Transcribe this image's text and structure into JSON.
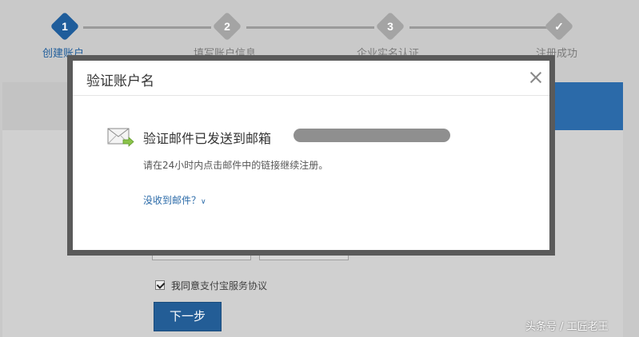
{
  "steps": [
    {
      "number": "1",
      "label": "创建账户",
      "state": "active"
    },
    {
      "number": "2",
      "label": "填写账户信息",
      "state": "pending"
    },
    {
      "number": "3",
      "label": "企业实名认证",
      "state": "pending"
    },
    {
      "number": "✓",
      "label": "注册成功",
      "state": "pending"
    }
  ],
  "form": {
    "agree_prefix": "我同意",
    "agree_link": "支付宝服务协议",
    "agree_checked": true,
    "next_label": "下一步"
  },
  "dialog": {
    "title": "验证账户名",
    "close_icon": "close-icon",
    "sent_text": "验证邮件已发送到邮箱",
    "email_obscured": true,
    "instruction": "请在24小时内点击邮件中的链接继续注册。",
    "no_mail_link": "没收到邮件？",
    "mail_icon": "envelope-arrow-icon"
  },
  "watermark": "头条号 / 工匠老王",
  "colors": {
    "active_step": "#1f5d9b",
    "link": "#2a6aa8",
    "button": "#235d96",
    "overlay": "#c9c9c9"
  }
}
